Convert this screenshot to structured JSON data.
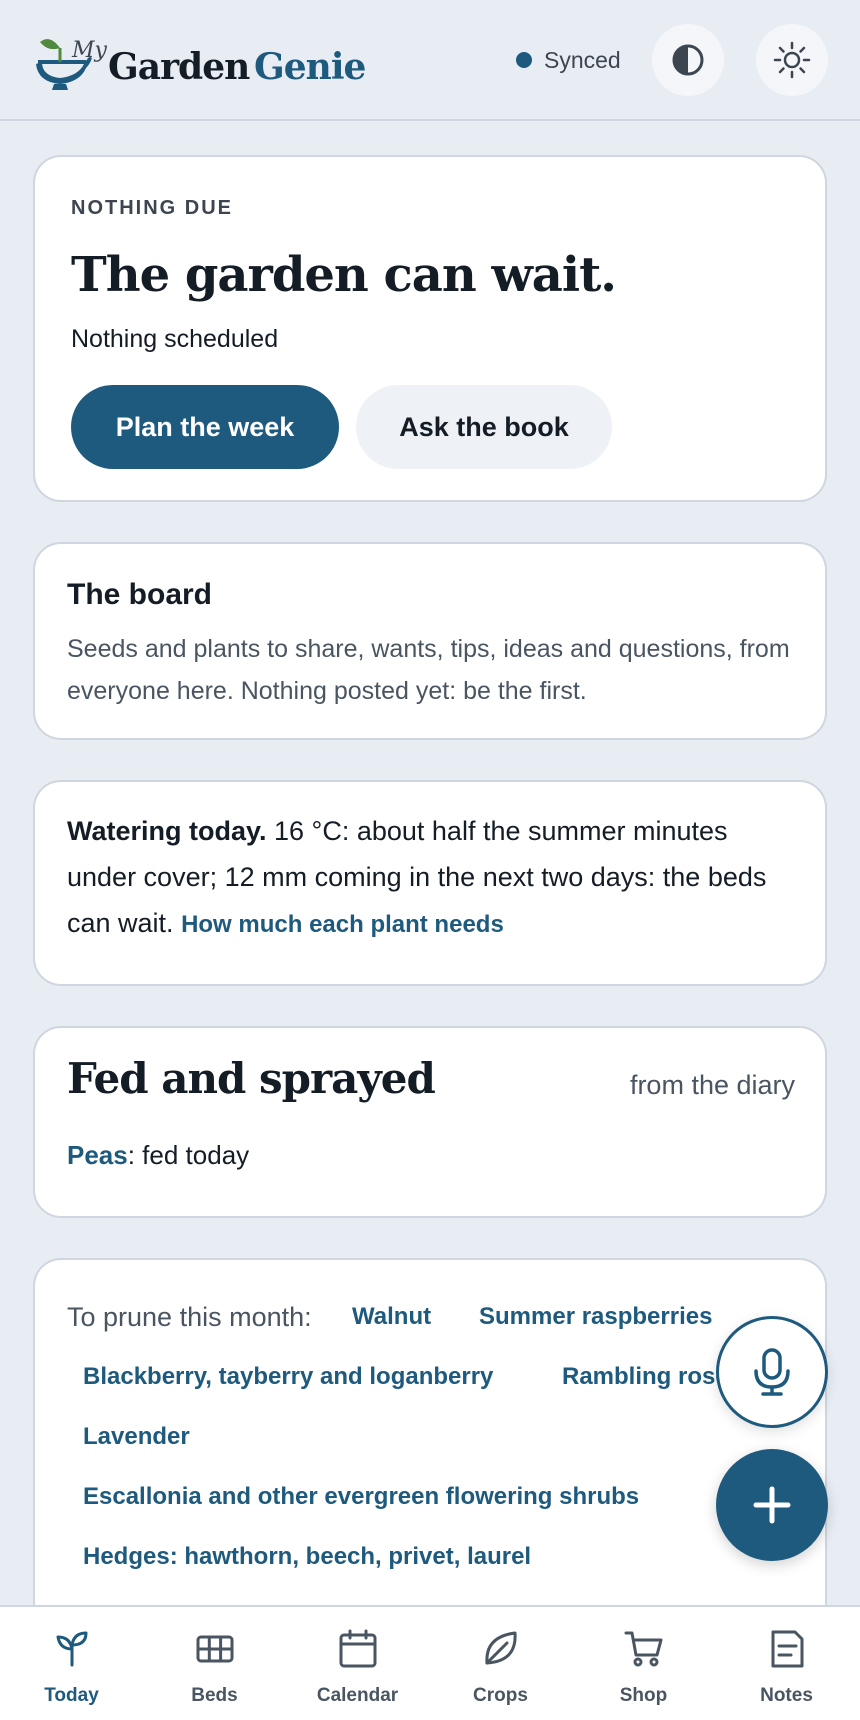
{
  "app": {
    "logo_my": "My",
    "logo_garden": "Garden",
    "logo_genie": "Genie"
  },
  "header": {
    "sync_status": "Synced",
    "contrast_icon": "contrast-icon",
    "theme_icon": "sun-icon"
  },
  "hero": {
    "eyebrow": "NOTHING DUE",
    "title": "The garden can wait.",
    "subtitle": "Nothing scheduled",
    "primary_button": "Plan the week",
    "secondary_button": "Ask the book"
  },
  "board": {
    "title": "The board",
    "body": "Seeds and plants to share, wants, tips, ideas and questions, from everyone here. Nothing posted yet: be the first."
  },
  "watering": {
    "lead": "Watering today.",
    "body": " 16 °C: about half the summer minutes under cover; 12 mm coming in the next two days: the beds can wait. ",
    "link": "How much each plant needs"
  },
  "fed": {
    "title": "Fed and sprayed",
    "source": "from the diary",
    "crop": "Peas",
    "status": ": fed today"
  },
  "prune": {
    "label": "To prune this month:",
    "items": [
      "Walnut",
      "Summer raspberries",
      "Blackberry, tayberry and loganberry",
      "Rambling roses",
      "Lavender",
      "Escallonia and other evergreen flowering shrubs",
      "Hedges: hawthorn, beech, privet, laurel"
    ]
  },
  "fab": {
    "mic_icon": "microphone-icon",
    "add_icon": "plus-icon"
  },
  "nav": {
    "items": [
      {
        "label": "Today",
        "icon": "sprout-icon",
        "active": true
      },
      {
        "label": "Beds",
        "icon": "grid-icon",
        "active": false
      },
      {
        "label": "Calendar",
        "icon": "calendar-icon",
        "active": false
      },
      {
        "label": "Crops",
        "icon": "leaf-icon",
        "active": false
      },
      {
        "label": "Shop",
        "icon": "cart-icon",
        "active": false
      },
      {
        "label": "Notes",
        "icon": "note-icon",
        "active": false
      }
    ]
  },
  "colors": {
    "accent": "#1e5a7e",
    "background": "#e8edf4",
    "card": "#ffffff",
    "text": "#141c26"
  }
}
